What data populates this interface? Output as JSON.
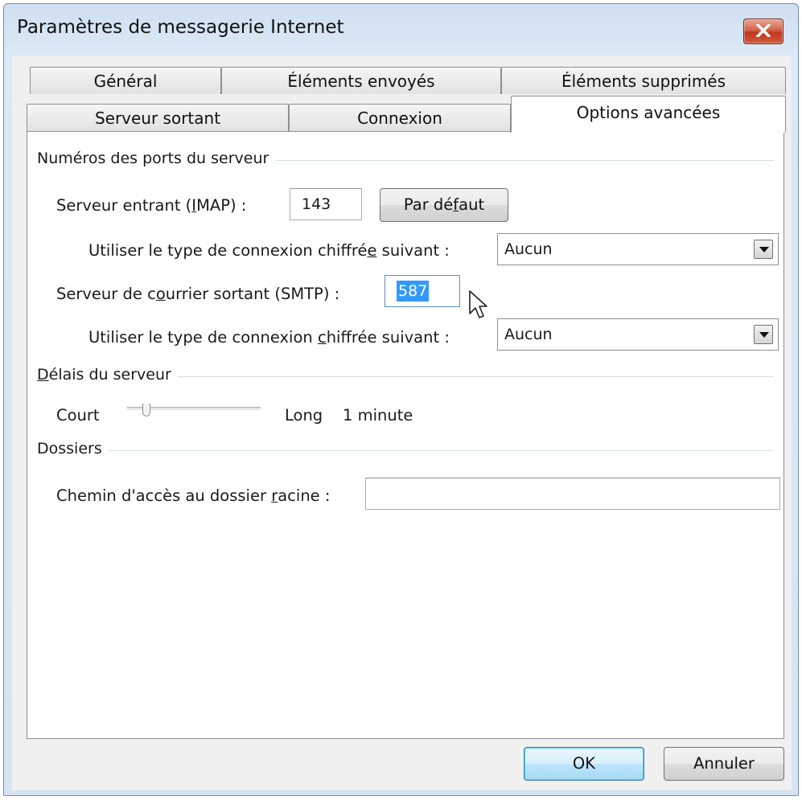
{
  "window": {
    "title": "Paramètres de messagerie Internet"
  },
  "tabs": {
    "row1": [
      "Général",
      "Éléments envoyés",
      "Éléments supprimés"
    ],
    "row2": [
      "Serveur sortant",
      "Connexion",
      "Options avancées"
    ],
    "active": "Options avancées"
  },
  "ports": {
    "group_label": "Numéros des ports du serveur",
    "incoming_label_pre": "Serveur entrant (",
    "incoming_label_key": "I",
    "incoming_label_post": "MAP) :",
    "incoming_value": "143",
    "default_btn_pre": "Par dé",
    "default_btn_key": "f",
    "default_btn_post": "aut",
    "enc1_label_pre": "Utiliser le type de connexion chiffré",
    "enc1_label_key": "e",
    "enc1_label_post": " suivant :",
    "enc1_value": "Aucun",
    "outgoing_label_pre": "Serveur de c",
    "outgoing_label_key": "o",
    "outgoing_label_post": "urrier sortant (SMTP) :",
    "outgoing_value": "587",
    "enc2_label_pre": "Utiliser le type de connexion ",
    "enc2_label_key": "c",
    "enc2_label_post": "hiffrée suivant :",
    "enc2_value": "Aucun"
  },
  "timeouts": {
    "group_label_key": "D",
    "group_label_post": "élais du serveur",
    "short_label": "Court",
    "long_label": "Long",
    "value_text": "1 minute",
    "slider_level": 0.12
  },
  "folders": {
    "group_label": "Dossiers",
    "root_label_pre": "Chemin d'accès au dossier ",
    "root_label_key": "r",
    "root_label_post": "acine :",
    "root_value": ""
  },
  "buttons": {
    "ok": "OK",
    "cancel": "Annuler"
  },
  "colors": {
    "selection": "#3399ff",
    "close": "#c1371f",
    "accent": "#3c7fb1"
  },
  "icons": {
    "close": "close-icon",
    "dropdown": "chevron-down-icon",
    "cursor": "mouse-pointer-icon"
  }
}
